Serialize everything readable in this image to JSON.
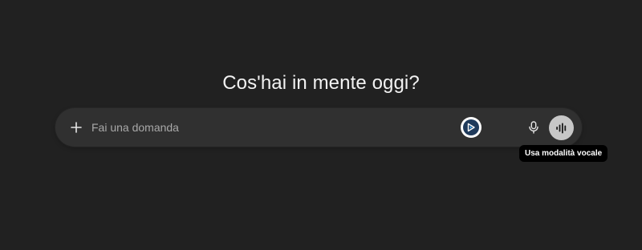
{
  "main": {
    "headline": "Cos'hai in mente oggi?"
  },
  "composer": {
    "placeholder": "Fai una domanda",
    "value": "",
    "buttons": {
      "add": {
        "icon": "plus-icon"
      },
      "extension": {
        "icon": "extension-logo-icon"
      },
      "dictate": {
        "icon": "microphone-icon"
      },
      "voice_mode": {
        "icon": "voice-waveform-icon"
      }
    }
  },
  "tooltip": {
    "text": "Usa modalità vocale"
  },
  "colors": {
    "background": "#212121",
    "composer": "#303030",
    "voice_button": "#c7c7c7",
    "extension_badge": "#1f3a5b"
  }
}
